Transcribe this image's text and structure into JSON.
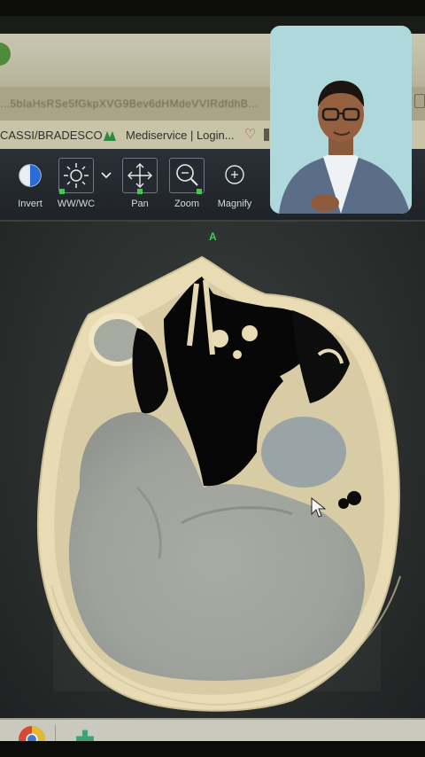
{
  "browser": {
    "url_text": "...5bIaHsRSe5fGkpXVG9Bev6dHMdeVVIRdfdhB...",
    "bookmarks": [
      {
        "label": "CASSI/BRADESCO"
      },
      {
        "label": "Mediservice | Login..."
      }
    ]
  },
  "toolbar": {
    "tools": [
      {
        "label": "Invert",
        "icon": "invert-icon"
      },
      {
        "label": "WW/WC",
        "icon": "brightness-icon"
      },
      {
        "label": "",
        "icon": "chevron-down-icon"
      },
      {
        "label": "Pan",
        "icon": "pan-arrows-icon"
      },
      {
        "label": "Zoom",
        "icon": "zoom-icon"
      },
      {
        "label": "Magnify",
        "icon": "magnify-icon"
      }
    ]
  },
  "viewer": {
    "orientation_marker": "A",
    "image_type": "axial head CT"
  },
  "taskbar": {
    "apps": [
      {
        "icon": "chrome-icon"
      },
      {
        "icon": "plus-app-icon"
      }
    ]
  },
  "webcam": {
    "subject": "presenter-video"
  },
  "colors": {
    "toolbar_bg": "#22272d",
    "active_indicator": "#42c84a",
    "orientation_marker": "#39d14c",
    "bookmark_bar": "#c8c4a8"
  }
}
